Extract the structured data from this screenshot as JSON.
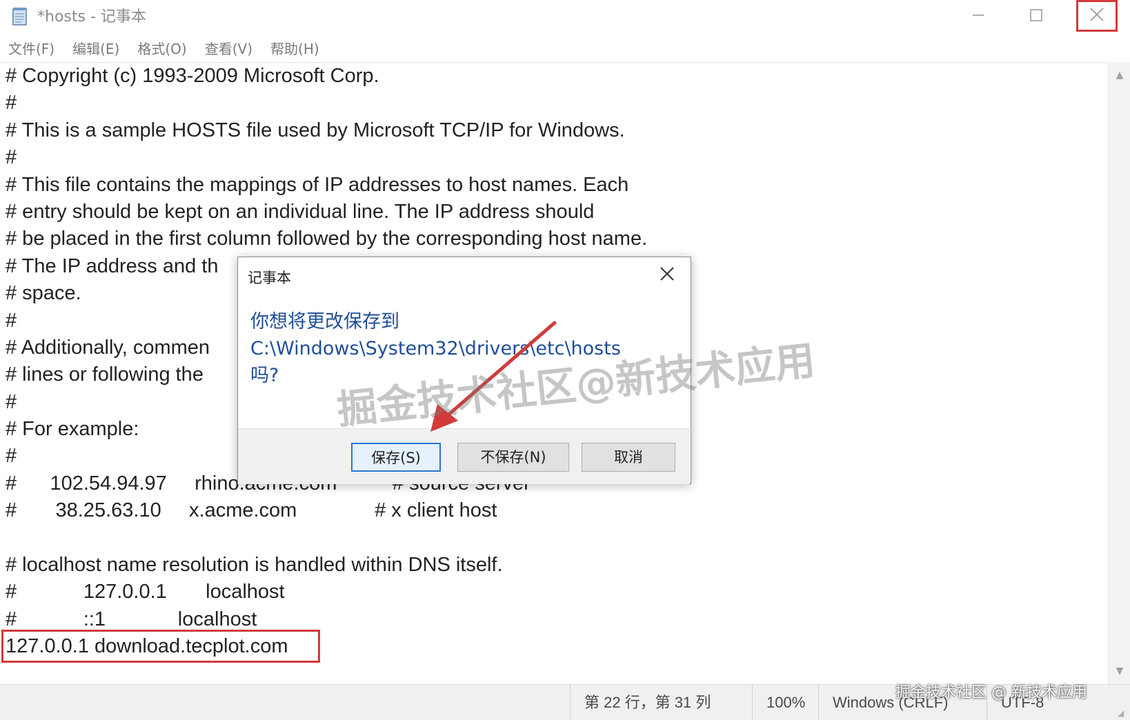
{
  "window": {
    "title": "*hosts - 记事本",
    "app_icon": "notepad-icon",
    "controls": {
      "minimize": "minimize-icon",
      "maximize": "maximize-icon",
      "close": "close-icon"
    }
  },
  "menu": {
    "items": [
      {
        "label": "文件(F)"
      },
      {
        "label": "编辑(E)"
      },
      {
        "label": "格式(O)"
      },
      {
        "label": "查看(V)"
      },
      {
        "label": "帮助(H)"
      }
    ]
  },
  "editor": {
    "lines": [
      "# Copyright (c) 1993-2009 Microsoft Corp.",
      "#",
      "# This is a sample HOSTS file used by Microsoft TCP/IP for Windows.",
      "#",
      "# This file contains the mappings of IP addresses to host names. Each",
      "# entry should be kept on an individual line. The IP address should",
      "# be placed in the first column followed by the corresponding host name.",
      "# The IP address and th                                                                        one",
      "# space.",
      "#",
      "# Additionally, commen                                                                          al",
      "# lines or following the",
      "#",
      "# For example:",
      "#",
      "#      102.54.94.97     rhino.acme.com          # source server",
      "#       38.25.63.10     x.acme.com              # x client host",
      "",
      "# localhost name resolution is handled within DNS itself.",
      "#            127.0.0.1       localhost",
      "#            ::1             localhost",
      "127.0.0.1 download.tecplot.com"
    ]
  },
  "status": {
    "position": "第 22 行，第 31 列",
    "zoom": "100%",
    "line_ending": "Windows (CRLF)",
    "encoding": "UTF-8"
  },
  "dialog": {
    "title": "记事本",
    "message_line1": "你想将更改保存到",
    "message_line2": "C:\\Windows\\System32\\drivers\\etc\\hosts",
    "message_line3": "吗?",
    "buttons": {
      "save": "保存(S)",
      "dont_save": "不保存(N)",
      "cancel": "取消"
    }
  },
  "watermark": {
    "large": "掘金技术社区@新技术应用",
    "small": "掘金技术社区 @ 新技术应用"
  },
  "colors": {
    "annotation_red": "#d23a3a",
    "dialog_text_blue": "#1f4e9a",
    "focus_blue": "#2b74d6"
  }
}
